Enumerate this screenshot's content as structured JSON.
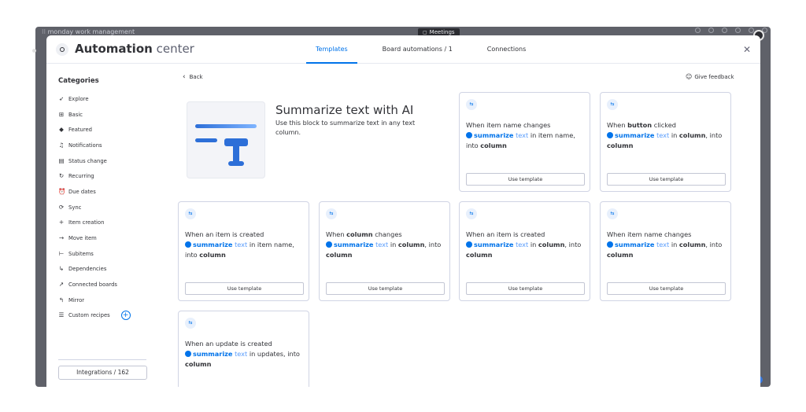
{
  "backdrop": {
    "logo_text": "monday work management",
    "tab_label": "Meetings"
  },
  "header": {
    "title_bold": "Automation",
    "title_rest": "center",
    "tabs": [
      {
        "label": "Templates",
        "active": true
      },
      {
        "label": "Board automations / 1",
        "active": false
      },
      {
        "label": "Connections",
        "active": false
      }
    ]
  },
  "sidebar": {
    "title": "Categories",
    "items": [
      {
        "label": "Explore",
        "icon": "rocket-icon"
      },
      {
        "label": "Basic",
        "icon": "blocks-icon"
      },
      {
        "label": "Featured",
        "icon": "diamond-icon"
      },
      {
        "label": "Notifications",
        "icon": "bell-icon"
      },
      {
        "label": "Status change",
        "icon": "status-icon"
      },
      {
        "label": "Recurring",
        "icon": "recurring-icon"
      },
      {
        "label": "Due dates",
        "icon": "alarm-icon"
      },
      {
        "label": "Sync",
        "icon": "sync-icon"
      },
      {
        "label": "Item creation",
        "icon": "plus-icon"
      },
      {
        "label": "Move item",
        "icon": "arrow-right-icon"
      },
      {
        "label": "Subitems",
        "icon": "subitems-icon"
      },
      {
        "label": "Dependencies",
        "icon": "dependency-icon"
      },
      {
        "label": "Connected boards",
        "icon": "arrow-diagonal-icon"
      },
      {
        "label": "Mirror",
        "icon": "mirror-icon"
      },
      {
        "label": "Custom recipes",
        "icon": "sliders-icon"
      }
    ],
    "integrations_label": "Integrations / 162",
    "apps": [
      "outlook-icon",
      "gmail-icon",
      "slack-icon",
      "google-calendar-icon"
    ]
  },
  "content": {
    "back_label": "Back",
    "feedback_label": "Give feedback",
    "hero": {
      "title": "Summarize text with AI",
      "description": "Use this block to summarize text in any text column."
    },
    "use_template_label": "Use template",
    "cards": [
      {
        "prefix": "When item name changes",
        "trigger_bold": "",
        "ai_text": "summarize",
        "ai_plain": "text",
        "middle": "in item name, into",
        "target": "column"
      },
      {
        "prefix": "When",
        "trigger_bold": "button",
        "trigger_suffix": "clicked",
        "ai_text": "summarize",
        "ai_plain": "text",
        "middle": "in",
        "mid_bold": "column",
        "into": ", into",
        "target": "column"
      },
      {
        "prefix": "When an item is created",
        "ai_text": "summarize",
        "ai_plain": "text",
        "middle": "in item name, into",
        "target": "column"
      },
      {
        "prefix": "When",
        "trigger_bold": "column",
        "trigger_suffix": "changes",
        "ai_text": "summarize",
        "ai_plain": "text",
        "middle": "in",
        "mid_bold": "column",
        "into": ", into",
        "target": "column"
      },
      {
        "prefix": "When an item is created",
        "ai_text": "summarize",
        "ai_plain": "text",
        "middle": "in",
        "mid_bold": "column",
        "into": ", into",
        "target": "column"
      },
      {
        "prefix": "When item name changes",
        "ai_text": "summarize",
        "ai_plain": "text",
        "middle": "in",
        "mid_bold": "column",
        "into": ", into",
        "target": "column"
      },
      {
        "prefix": "When an update is created",
        "ai_text": "summarize",
        "ai_plain": "text",
        "middle": "in updates, into",
        "target": "column"
      }
    ]
  },
  "colors": {
    "accent": "#0073ea",
    "text": "#323338",
    "border": "#d0d4e4"
  }
}
